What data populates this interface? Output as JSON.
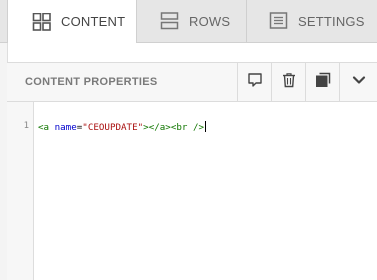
{
  "tabs": {
    "content": {
      "label": "CONTENT",
      "icon": "grid-icon"
    },
    "rows": {
      "label": "ROWS",
      "icon": "rows-icon"
    },
    "settings": {
      "label": "SETTINGS",
      "icon": "settings-list-icon"
    }
  },
  "panel": {
    "title": "CONTENT PROPERTIES",
    "actions": [
      "comment-icon",
      "trash-icon",
      "duplicate-icon",
      "chevron-down-icon"
    ]
  },
  "editor": {
    "line_number": "1",
    "code": {
      "t1": "<a ",
      "attr": "name",
      "eq": "=",
      "value": "\"CEOUPDATE\"",
      "t2": "></a><br />"
    }
  }
}
